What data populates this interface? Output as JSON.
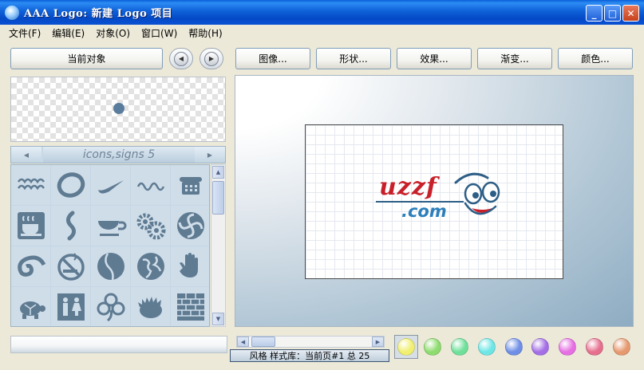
{
  "window": {
    "title": "AAA Logo: 新建 Logo 项目",
    "controls": {
      "minimize": "_",
      "maximize": "□",
      "close": "✕"
    }
  },
  "menu": [
    "文件(F)",
    "编辑(E)",
    "对象(O)",
    "窗口(W)",
    "帮助(H)"
  ],
  "toolbar": {
    "current_object": "当前对象",
    "prev": "◀",
    "next": "▶",
    "image": "图像...",
    "shape": "形状...",
    "effect": "效果...",
    "gradient": "渐变...",
    "color": "颜色..."
  },
  "library": {
    "category": "icons,signs 5",
    "prev": "◀",
    "next": "▶",
    "icons": [
      "waves-icon",
      "ring-icon",
      "swoosh-icon",
      "wave-line-icon",
      "telephone-icon",
      "coffee-cup-icon",
      "squiggle-icon",
      "teacup-icon",
      "gears-icon",
      "spiral-icon",
      "swirl-icon",
      "no-smoking-icon",
      "moon-face-icon",
      "globe-icon",
      "hand-icon",
      "turtle-icon",
      "restroom-icon",
      "clover-icon",
      "hedgehog-icon",
      "brick-wall-icon"
    ]
  },
  "canvas": {
    "logo_text": "uzzf",
    "logo_subtext": ".com"
  },
  "status_text": "风格 样式库：当前页#1 总 25",
  "swatches": [
    "#f0ef70",
    "#8edc6e",
    "#6fe09a",
    "#6ee6e6",
    "#6f8fe6",
    "#a46fe6",
    "#e66fe3",
    "#e66f8e",
    "#e6996f"
  ],
  "colors": {
    "titlebar": "#0a52d4",
    "window_bg": "#ece9d8",
    "logo_red": "#c8202a",
    "logo_blue": "#2d7fba"
  }
}
